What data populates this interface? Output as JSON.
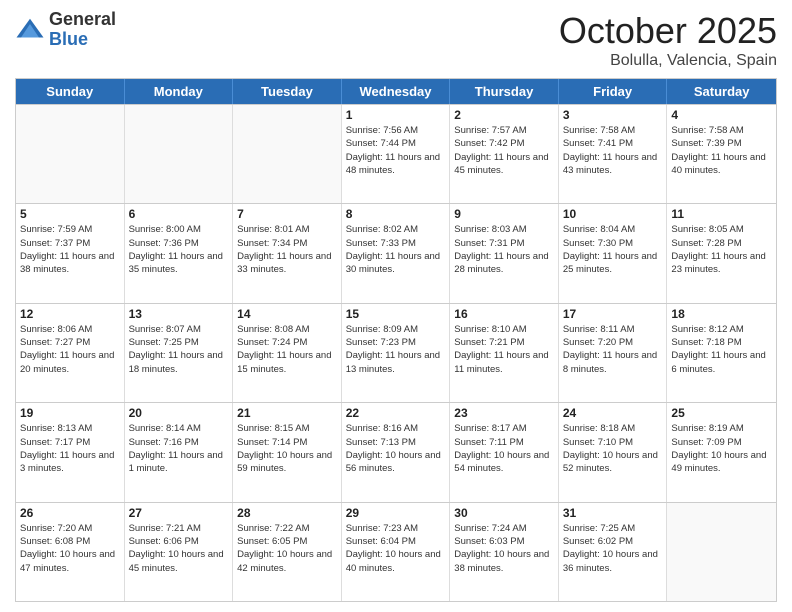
{
  "logo": {
    "general": "General",
    "blue": "Blue"
  },
  "title": "October 2025",
  "subtitle": "Bolulla, Valencia, Spain",
  "days_of_week": [
    "Sunday",
    "Monday",
    "Tuesday",
    "Wednesday",
    "Thursday",
    "Friday",
    "Saturday"
  ],
  "weeks": [
    [
      {
        "day": "",
        "sunrise": "",
        "sunset": "",
        "daylight": "",
        "empty": true
      },
      {
        "day": "",
        "sunrise": "",
        "sunset": "",
        "daylight": "",
        "empty": true
      },
      {
        "day": "",
        "sunrise": "",
        "sunset": "",
        "daylight": "",
        "empty": true
      },
      {
        "day": "1",
        "sunrise": "Sunrise: 7:56 AM",
        "sunset": "Sunset: 7:44 PM",
        "daylight": "Daylight: 11 hours and 48 minutes."
      },
      {
        "day": "2",
        "sunrise": "Sunrise: 7:57 AM",
        "sunset": "Sunset: 7:42 PM",
        "daylight": "Daylight: 11 hours and 45 minutes."
      },
      {
        "day": "3",
        "sunrise": "Sunrise: 7:58 AM",
        "sunset": "Sunset: 7:41 PM",
        "daylight": "Daylight: 11 hours and 43 minutes."
      },
      {
        "day": "4",
        "sunrise": "Sunrise: 7:58 AM",
        "sunset": "Sunset: 7:39 PM",
        "daylight": "Daylight: 11 hours and 40 minutes."
      }
    ],
    [
      {
        "day": "5",
        "sunrise": "Sunrise: 7:59 AM",
        "sunset": "Sunset: 7:37 PM",
        "daylight": "Daylight: 11 hours and 38 minutes."
      },
      {
        "day": "6",
        "sunrise": "Sunrise: 8:00 AM",
        "sunset": "Sunset: 7:36 PM",
        "daylight": "Daylight: 11 hours and 35 minutes."
      },
      {
        "day": "7",
        "sunrise": "Sunrise: 8:01 AM",
        "sunset": "Sunset: 7:34 PM",
        "daylight": "Daylight: 11 hours and 33 minutes."
      },
      {
        "day": "8",
        "sunrise": "Sunrise: 8:02 AM",
        "sunset": "Sunset: 7:33 PM",
        "daylight": "Daylight: 11 hours and 30 minutes."
      },
      {
        "day": "9",
        "sunrise": "Sunrise: 8:03 AM",
        "sunset": "Sunset: 7:31 PM",
        "daylight": "Daylight: 11 hours and 28 minutes."
      },
      {
        "day": "10",
        "sunrise": "Sunrise: 8:04 AM",
        "sunset": "Sunset: 7:30 PM",
        "daylight": "Daylight: 11 hours and 25 minutes."
      },
      {
        "day": "11",
        "sunrise": "Sunrise: 8:05 AM",
        "sunset": "Sunset: 7:28 PM",
        "daylight": "Daylight: 11 hours and 23 minutes."
      }
    ],
    [
      {
        "day": "12",
        "sunrise": "Sunrise: 8:06 AM",
        "sunset": "Sunset: 7:27 PM",
        "daylight": "Daylight: 11 hours and 20 minutes."
      },
      {
        "day": "13",
        "sunrise": "Sunrise: 8:07 AM",
        "sunset": "Sunset: 7:25 PM",
        "daylight": "Daylight: 11 hours and 18 minutes."
      },
      {
        "day": "14",
        "sunrise": "Sunrise: 8:08 AM",
        "sunset": "Sunset: 7:24 PM",
        "daylight": "Daylight: 11 hours and 15 minutes."
      },
      {
        "day": "15",
        "sunrise": "Sunrise: 8:09 AM",
        "sunset": "Sunset: 7:23 PM",
        "daylight": "Daylight: 11 hours and 13 minutes."
      },
      {
        "day": "16",
        "sunrise": "Sunrise: 8:10 AM",
        "sunset": "Sunset: 7:21 PM",
        "daylight": "Daylight: 11 hours and 11 minutes."
      },
      {
        "day": "17",
        "sunrise": "Sunrise: 8:11 AM",
        "sunset": "Sunset: 7:20 PM",
        "daylight": "Daylight: 11 hours and 8 minutes."
      },
      {
        "day": "18",
        "sunrise": "Sunrise: 8:12 AM",
        "sunset": "Sunset: 7:18 PM",
        "daylight": "Daylight: 11 hours and 6 minutes."
      }
    ],
    [
      {
        "day": "19",
        "sunrise": "Sunrise: 8:13 AM",
        "sunset": "Sunset: 7:17 PM",
        "daylight": "Daylight: 11 hours and 3 minutes."
      },
      {
        "day": "20",
        "sunrise": "Sunrise: 8:14 AM",
        "sunset": "Sunset: 7:16 PM",
        "daylight": "Daylight: 11 hours and 1 minute."
      },
      {
        "day": "21",
        "sunrise": "Sunrise: 8:15 AM",
        "sunset": "Sunset: 7:14 PM",
        "daylight": "Daylight: 10 hours and 59 minutes."
      },
      {
        "day": "22",
        "sunrise": "Sunrise: 8:16 AM",
        "sunset": "Sunset: 7:13 PM",
        "daylight": "Daylight: 10 hours and 56 minutes."
      },
      {
        "day": "23",
        "sunrise": "Sunrise: 8:17 AM",
        "sunset": "Sunset: 7:11 PM",
        "daylight": "Daylight: 10 hours and 54 minutes."
      },
      {
        "day": "24",
        "sunrise": "Sunrise: 8:18 AM",
        "sunset": "Sunset: 7:10 PM",
        "daylight": "Daylight: 10 hours and 52 minutes."
      },
      {
        "day": "25",
        "sunrise": "Sunrise: 8:19 AM",
        "sunset": "Sunset: 7:09 PM",
        "daylight": "Daylight: 10 hours and 49 minutes."
      }
    ],
    [
      {
        "day": "26",
        "sunrise": "Sunrise: 7:20 AM",
        "sunset": "Sunset: 6:08 PM",
        "daylight": "Daylight: 10 hours and 47 minutes."
      },
      {
        "day": "27",
        "sunrise": "Sunrise: 7:21 AM",
        "sunset": "Sunset: 6:06 PM",
        "daylight": "Daylight: 10 hours and 45 minutes."
      },
      {
        "day": "28",
        "sunrise": "Sunrise: 7:22 AM",
        "sunset": "Sunset: 6:05 PM",
        "daylight": "Daylight: 10 hours and 42 minutes."
      },
      {
        "day": "29",
        "sunrise": "Sunrise: 7:23 AM",
        "sunset": "Sunset: 6:04 PM",
        "daylight": "Daylight: 10 hours and 40 minutes."
      },
      {
        "day": "30",
        "sunrise": "Sunrise: 7:24 AM",
        "sunset": "Sunset: 6:03 PM",
        "daylight": "Daylight: 10 hours and 38 minutes."
      },
      {
        "day": "31",
        "sunrise": "Sunrise: 7:25 AM",
        "sunset": "Sunset: 6:02 PM",
        "daylight": "Daylight: 10 hours and 36 minutes."
      },
      {
        "day": "",
        "sunrise": "",
        "sunset": "",
        "daylight": "",
        "empty": true
      }
    ]
  ]
}
